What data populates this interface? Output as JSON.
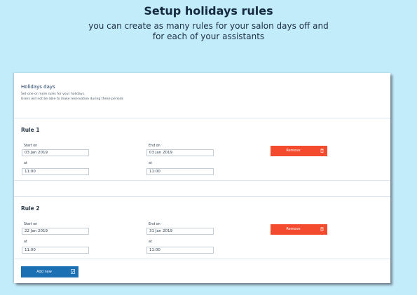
{
  "promo": {
    "headline": "Setup holidays rules",
    "subline": "you can create as many rules for your salon days off and for each of your assistants"
  },
  "section": {
    "title": "Holidays days",
    "description_line1": "Set one or more rules for your holidays.",
    "description_line2": "Users will not be able to make reservation during these periods"
  },
  "rules": [
    {
      "title": "Rule 1",
      "start_label": "Start on",
      "start_date": "03 Jan 2019",
      "start_at_label": "at",
      "start_time": "11:00",
      "end_label": "End on",
      "end_date": "03 Jan 2019",
      "end_at_label": "at",
      "end_time": "11:00",
      "remove_label": "Remove"
    },
    {
      "title": "Rule 2",
      "start_label": "Start on",
      "start_date": "22 Jan 2019",
      "start_at_label": "at",
      "start_time": "11:00",
      "end_label": "End on",
      "end_date": "31 Jan 2019",
      "end_at_label": "at",
      "end_time": "11:00",
      "remove_label": "Remove"
    }
  ],
  "add_button": {
    "label": "Add new",
    "icon": "edit-icon"
  },
  "icons": {
    "remove": "trash-icon"
  },
  "colors": {
    "background": "#c3ecfb",
    "remove_button": "#f44a2e",
    "add_button": "#1b6fb3",
    "section_title": "#1f3f66"
  }
}
